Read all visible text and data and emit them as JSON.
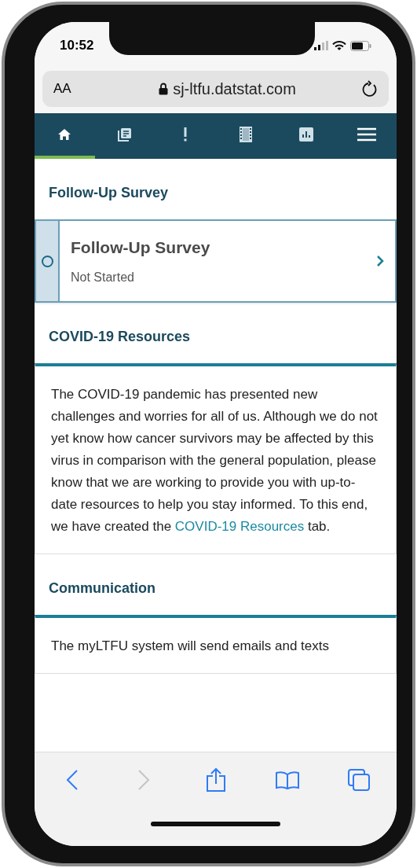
{
  "status_bar": {
    "time": "10:52"
  },
  "address_bar": {
    "text_size_label": "AA",
    "url": "sj-ltfu.datstat.com"
  },
  "nav_tabs": [
    {
      "kind": "home",
      "selected": true
    },
    {
      "kind": "documents",
      "selected": false
    },
    {
      "kind": "alert",
      "selected": false
    },
    {
      "kind": "film",
      "selected": false
    },
    {
      "kind": "chart",
      "selected": false
    },
    {
      "kind": "menu",
      "selected": false
    }
  ],
  "sections": [
    {
      "kind": "survey",
      "heading": "Follow-Up Survey",
      "card": {
        "title": "Follow-Up Survey",
        "status": "Not Started",
        "completed": false
      }
    },
    {
      "kind": "text",
      "heading": "COVID-19 Resources",
      "paragraph": [
        "The COVID-19 pandemic has presented new challenges and worries for all of us.  Although we do not yet know how cancer survivors may be affected by this virus in comparison with the general population, please know that we are working to provide you with up-to-date resources to help you stay informed.  To this end, we have created the ",
        "COVID-19 Resources",
        " tab."
      ]
    },
    {
      "kind": "text",
      "heading": "Communication",
      "paragraph": [
        "The myLTFU system will send emails and texts"
      ]
    }
  ],
  "toolbar": [
    {
      "kind": "back",
      "disabled": false
    },
    {
      "kind": "forward",
      "disabled": true
    },
    {
      "kind": "share",
      "disabled": false
    },
    {
      "kind": "bookmarks",
      "disabled": false
    },
    {
      "kind": "tabs",
      "disabled": false
    }
  ]
}
